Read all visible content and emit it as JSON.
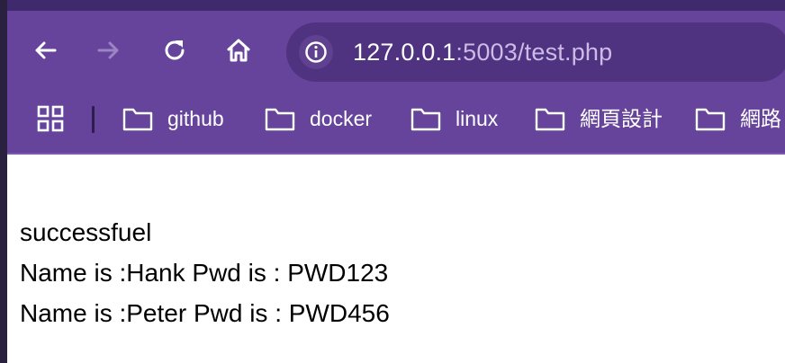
{
  "address_bar": {
    "host": "127.0.0.1",
    "rest": ":5003/test.php"
  },
  "icons": {
    "back": "arrow-left-icon",
    "forward": "arrow-right-icon",
    "reload": "reload-icon",
    "home": "home-icon",
    "site_info": "info-icon",
    "apps": "apps-grid-icon",
    "folder": "folder-icon"
  },
  "bookmarks": [
    {
      "label": "github"
    },
    {
      "label": "docker"
    },
    {
      "label": "linux"
    },
    {
      "label": "網頁設計"
    },
    {
      "label": "網路"
    }
  ],
  "page": {
    "lines": [
      "successfuel",
      "Name is :Hank Pwd is : PWD123",
      "Name is :Peter Pwd is : PWD456"
    ]
  },
  "colors": {
    "toolbar": "#66449c",
    "omnibox": "#4f3380",
    "url_host": "#ffffff",
    "url_rest": "#cbbbe6"
  }
}
